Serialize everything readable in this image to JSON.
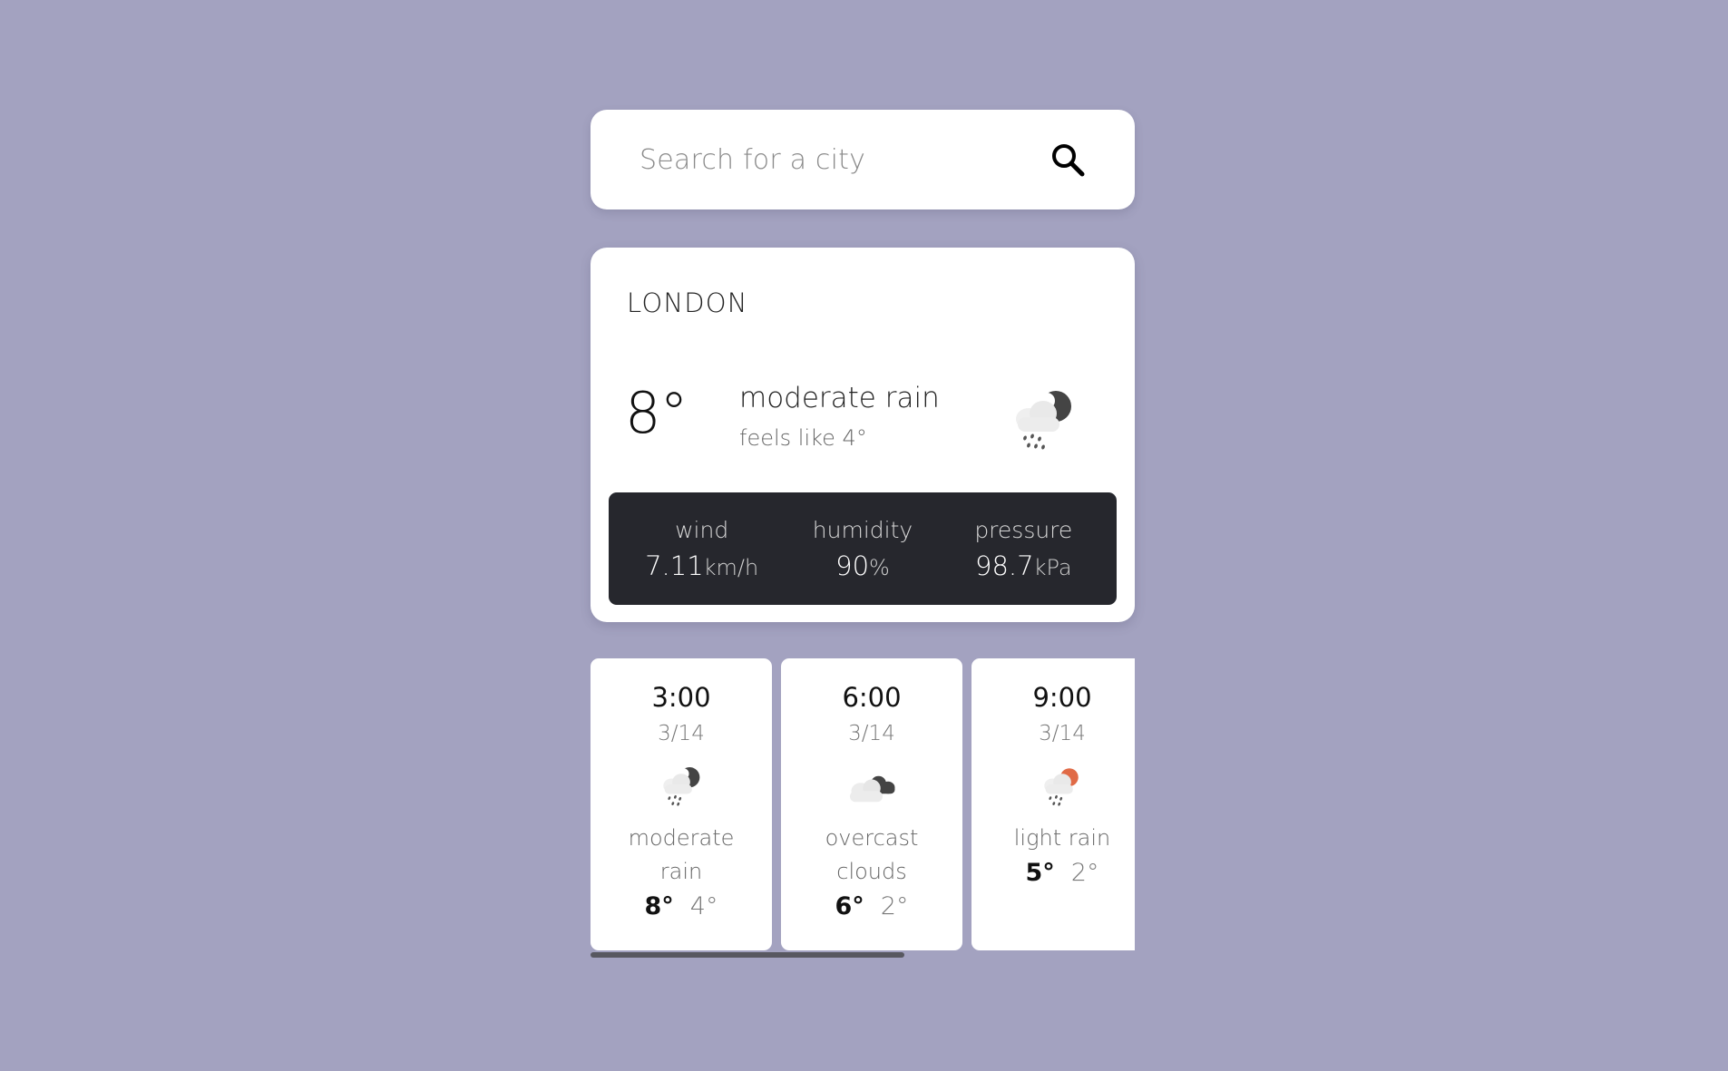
{
  "search": {
    "placeholder": "Search for a city"
  },
  "current": {
    "city": "LONDON",
    "temp": "8°",
    "description": "moderate rain",
    "feels_like": "feels like 4°",
    "icon": "rain-moon-icon"
  },
  "stats": {
    "wind": {
      "label": "wind",
      "value": "7.11",
      "unit": "km/h"
    },
    "humidity": {
      "label": "humidity",
      "value": "90",
      "unit": "%"
    },
    "pressure": {
      "label": "pressure",
      "value": "98.7",
      "unit": "kPa"
    }
  },
  "forecast": [
    {
      "time": "3:00",
      "date": "3/14",
      "desc": "moderate rain",
      "max": "8°",
      "min": "4°",
      "icon": "rain-moon-icon"
    },
    {
      "time": "6:00",
      "date": "3/14",
      "desc": "overcast clouds",
      "max": "6°",
      "min": "2°",
      "icon": "overcast-clouds-icon"
    },
    {
      "time": "9:00",
      "date": "3/14",
      "desc": "light rain",
      "max": "5°",
      "min": "2°",
      "icon": "rain-sun-icon"
    }
  ],
  "colors": {
    "background": "#a3a2c0",
    "stats_panel": "#26272d",
    "sun": "#e06a46",
    "moon": "#444444"
  }
}
